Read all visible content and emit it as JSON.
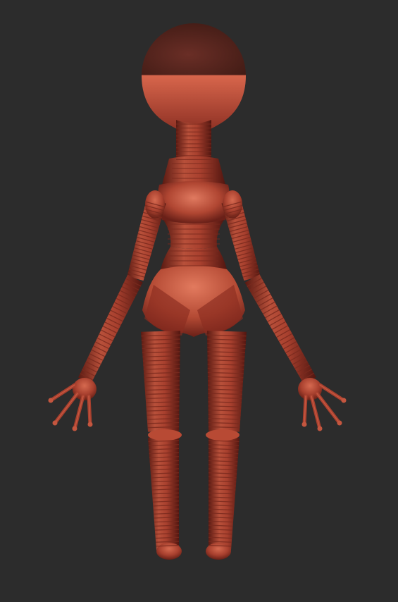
{
  "scene": {
    "background": "#2c2c2c",
    "subject": "mannequin-figure",
    "palette": {
      "skin_light": "#d06048",
      "skin_mid": "#a8402e",
      "skin_dark": "#6e2218",
      "skin_shadow": "#4a1410",
      "head_top": "#5a2620",
      "ring_line": "#7a2a1e"
    }
  }
}
